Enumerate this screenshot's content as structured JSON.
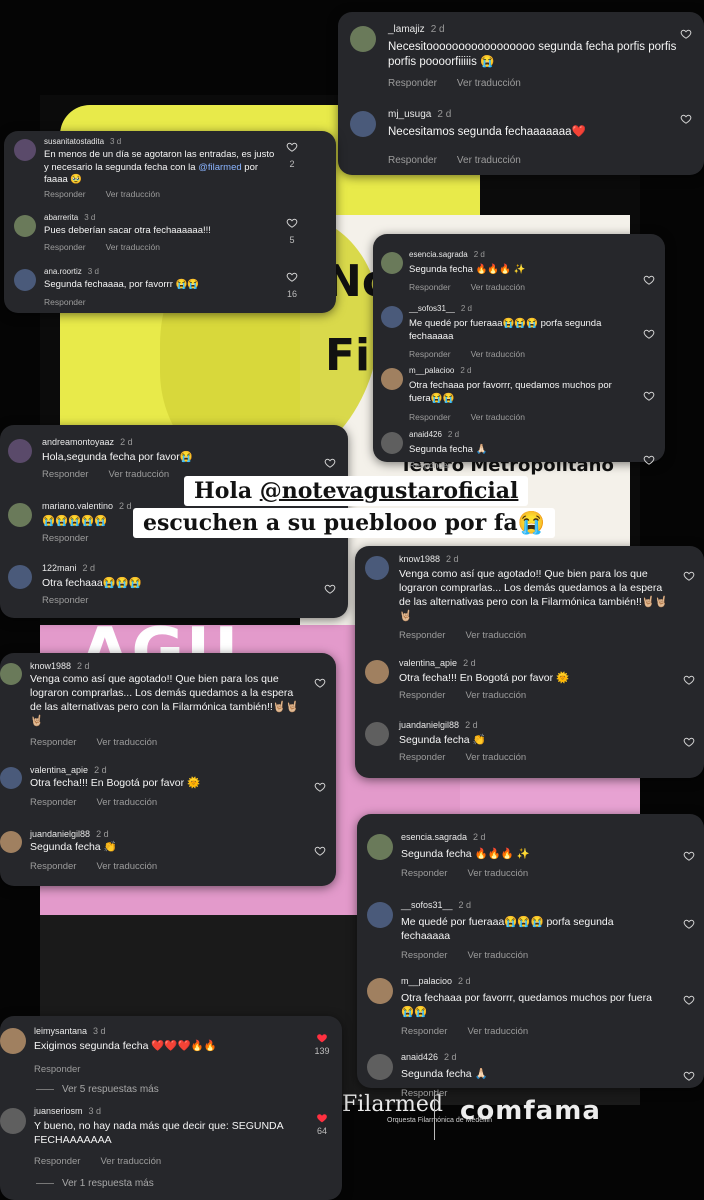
{
  "banner": {
    "line1_prefix": "Hola ",
    "line1_handle": "@notevagustaroficial",
    "line2": "escuchen a su pueblooo por fa😭"
  },
  "logos": {
    "filarmed": "Filarmed",
    "filarmed_sub": "Orquesta Filarmónica de Medellín",
    "comfama": "comfama"
  },
  "poster": {
    "big_text": "No\nFil",
    "agu": "AGU",
    "teatro": "Teatro Metropolitano"
  },
  "labels": {
    "reply": "Responder",
    "translate": "Ver traducción"
  },
  "panel_top_right": [
    {
      "user": "_lamajiz",
      "ago": "2 d",
      "text": "Necesitooooooooooooooooo segunda fecha porfis porfis porfis poooorfiiiiis 😭",
      "translate": true
    },
    {
      "user": "mj_usuga",
      "ago": "2 d",
      "text": "Necesitamos segunda fechaaaaaaa❤️",
      "translate": true
    }
  ],
  "panel_top_left": [
    {
      "user": "susanitatostadita",
      "ago": "3 d",
      "text_pre": "En menos de un día se agotaron las entradas, es justo y necesario la segunda fecha con la ",
      "mention": "@filarmed",
      "text_post": " por faaaa 🥹",
      "likes": "2",
      "translate": true
    },
    {
      "user": "abarrerita",
      "ago": "3 d",
      "text": "Pues deberían sacar otra fechaaaaaa!!!",
      "likes": "5",
      "translate": true
    },
    {
      "user": "ana.roortiz",
      "ago": "3 d",
      "text": "Segunda fechaaaa, por favorrr 😭😭",
      "likes": "16",
      "translate": false
    }
  ],
  "panel_mid_right": [
    {
      "user": "esencia.sagrada",
      "ago": "2 d",
      "text": "Segunda fecha 🔥🔥🔥 ✨",
      "translate": true
    },
    {
      "user": "__sofos31__",
      "ago": "2 d",
      "text": "Me quedé por fueraaa😭😭😭 porfa segunda fechaaaaa",
      "translate": true
    },
    {
      "user": "m__palacioo",
      "ago": "2 d",
      "text": "Otra fechaaa por favorrr, quedamos muchos por fuera😭😭",
      "translate": true
    },
    {
      "user": "anaid426",
      "ago": "2 d",
      "text": "Segunda fecha 🙏🏻",
      "translate": false
    }
  ],
  "panel_mid_left": [
    {
      "user": "andreamontoyaaz",
      "ago": "2 d",
      "text": "Hola,segunda fecha por favor😭",
      "translate": true
    },
    {
      "user": "mariano.valentino",
      "ago": "2 d",
      "text": "😭😭😭😭😭",
      "translate": false
    },
    {
      "user": "122mani",
      "ago": "2 d",
      "text": "Otra fechaaa😭😭😭",
      "translate": false
    }
  ],
  "panel_know_right": [
    {
      "user": "know1988",
      "ago": "2 d",
      "text": "Venga como así que agotado!! Que bien para los que lograron comprarlas... Los demás quedamos a la espera de las alternativas pero con la Filarmónica también!!🤘🏼🤘🏼🤘🏼",
      "translate": true
    },
    {
      "user": "valentina_apie",
      "ago": "2 d",
      "text": "Otra fecha!!! En Bogotá por favor 🌞",
      "translate": true
    },
    {
      "user": "juandanielgil88",
      "ago": "2 d",
      "text": "Segunda fecha 👏",
      "translate": true
    }
  ],
  "panel_know_left": [
    {
      "user": "know1988",
      "ago": "2 d",
      "text": "Venga como así que agotado!! Que bien para los que lograron comprarlas... Los demás quedamos a la espera de las alternativas pero con la Filarmónica también!!🤘🏼🤘🏼🤘🏼",
      "translate": true
    },
    {
      "user": "valentina_apie",
      "ago": "2 d",
      "text": "Otra fecha!!! En Bogotá por favor 🌞",
      "translate": true
    },
    {
      "user": "juandanielgil88",
      "ago": "2 d",
      "text": "Segunda fecha 👏",
      "translate": true
    }
  ],
  "panel_low_right": [
    {
      "user": "esencia.sagrada",
      "ago": "2 d",
      "text": "Segunda fecha 🔥🔥🔥 ✨",
      "translate": true
    },
    {
      "user": "__sofos31__",
      "ago": "2 d",
      "text": "Me quedé por fueraaa😭😭😭 porfa segunda fechaaaaa",
      "translate": true
    },
    {
      "user": "m__palacioo",
      "ago": "2 d",
      "text": "Otra fechaaa por favorrr, quedamos muchos por fuera😭😭",
      "translate": true
    },
    {
      "user": "anaid426",
      "ago": "2 d",
      "text": "Segunda fecha 🙏🏻",
      "translate": false
    }
  ],
  "panel_bottom_left": [
    {
      "user": "leimysantana",
      "ago": "3 d",
      "text": "Exigimos segunda fecha ❤️❤️❤️🔥🔥",
      "likes": "139",
      "translate": false,
      "more": "Ver 5 respuestas más"
    },
    {
      "user": "juanseriosm",
      "ago": "3 d",
      "text": "Y bueno, no hay nada más que decir que: SEGUNDA FECHAAAAAAA",
      "likes": "64",
      "translate": true,
      "more": "Ver 1 respuesta más"
    }
  ],
  "colors": {
    "panel": "#26272b",
    "heart_red": "#ff3040",
    "mention": "#8ab4ff"
  }
}
